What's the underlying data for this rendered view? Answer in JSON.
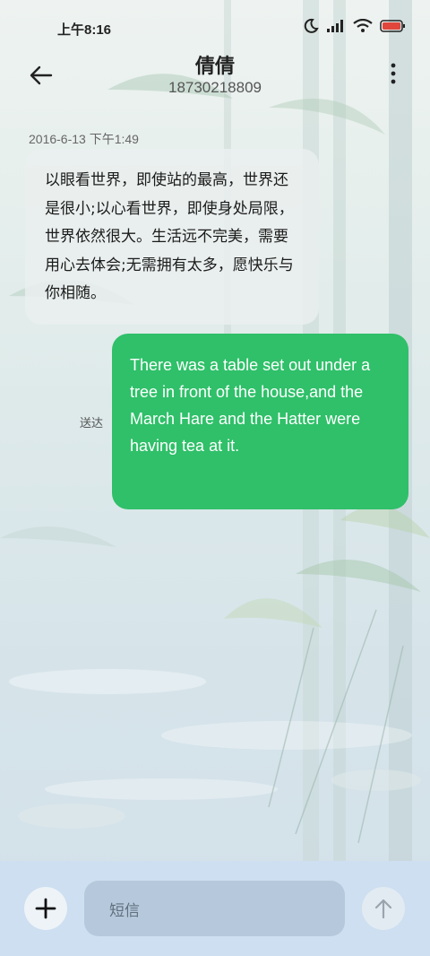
{
  "status_bar": {
    "time": "上午8:16",
    "battery_color": "#e0463c"
  },
  "header": {
    "contact_name": "倩倩",
    "contact_number": "18730218809"
  },
  "conversation": {
    "timestamp": "2016-6-13 下午1:49",
    "incoming_message": "以眼看世界，即使站的最高，世界还是很小;以心看世界，即使身处局限，世界依然很大。生活远不完美，需要用心去体会;无需拥有太多，愿快乐与你相随。",
    "outgoing_message": "There was a table set out under a tree in front of the house,and the March Hare and the Hatter were having tea at it.",
    "outgoing_status": "送达",
    "outgoing_bubble_color": "#2fc069"
  },
  "composer": {
    "placeholder": "短信"
  },
  "icons": {
    "back": "back-arrow-icon",
    "more": "more-vertical-icon",
    "add": "plus-icon",
    "send": "send-arrow-icon",
    "moon": "do-not-disturb-icon",
    "signal": "signal-icon",
    "wifi": "wifi-icon",
    "battery": "battery-icon"
  }
}
